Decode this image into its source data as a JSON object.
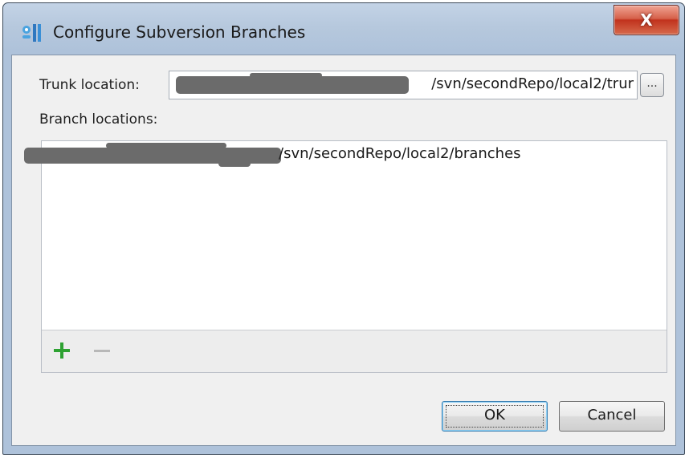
{
  "window": {
    "title": "Configure Subversion Branches",
    "close_label": "X"
  },
  "trunk": {
    "label": "Trunk location:",
    "value_visible": "/svn/secondRepo/local2/trur",
    "browse_label": "..."
  },
  "branches": {
    "label": "Branch locations:",
    "items": [
      {
        "value_visible": "/svn/secondRepo/local2/branches"
      }
    ]
  },
  "toolbar": {
    "add_symbol": "+",
    "remove_symbol": "−"
  },
  "buttons": {
    "ok_label": "OK",
    "cancel_label": "Cancel"
  },
  "colors": {
    "add_green": "#2ea232",
    "remove_gray": "#b8b8b8"
  }
}
